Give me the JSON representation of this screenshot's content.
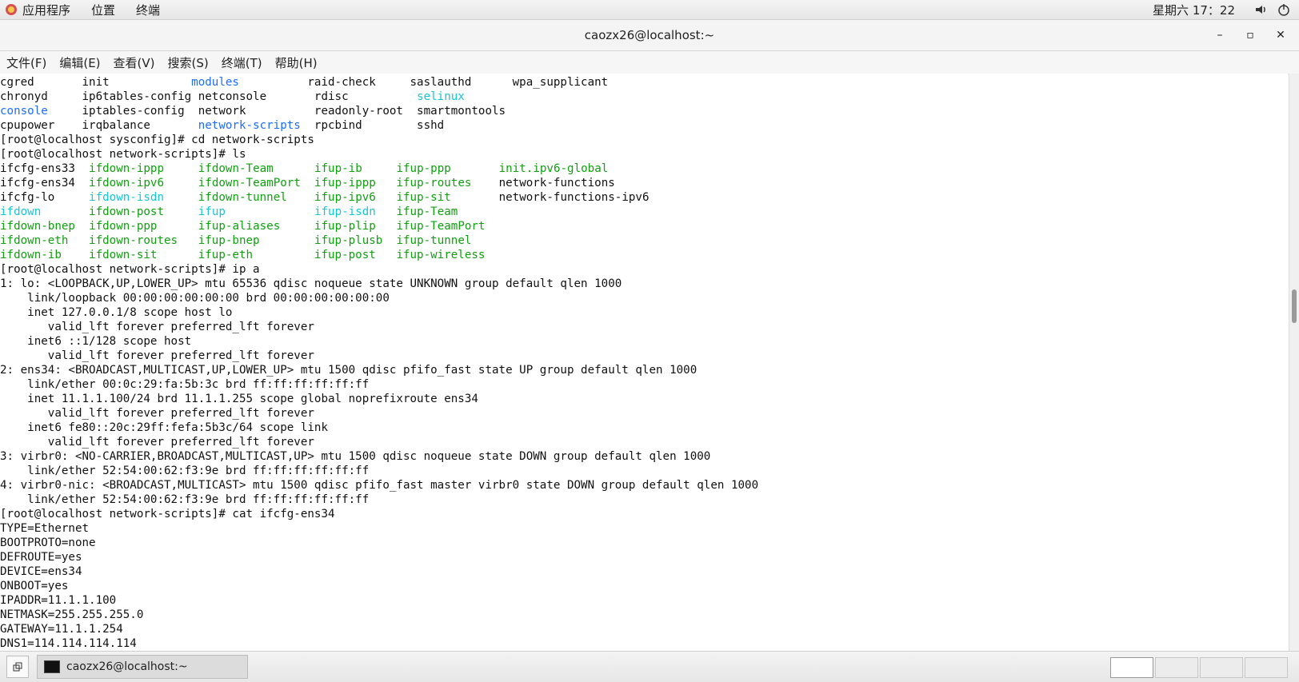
{
  "topbar": {
    "apps_label": "应用程序",
    "places_label": "位置",
    "terminal_label": "终端",
    "clock": "星期六 17：22"
  },
  "window": {
    "title": "caozx26@localhost:~",
    "controls": {
      "minimize": "–",
      "maximize": "▫",
      "close": "✕"
    }
  },
  "menubar": {
    "items": [
      "文件(F)",
      "编辑(E)",
      "查看(V)",
      "搜索(S)",
      "终端(T)",
      "帮助(H)"
    ]
  },
  "terminal": {
    "lines": [
      {
        "segs": [
          {
            "t": "cgred       init            ",
            "c": "normal"
          },
          {
            "t": "modules",
            "c": "blue"
          },
          {
            "t": "          raid-check     saslauthd      wpa_supplicant",
            "c": "normal"
          }
        ]
      },
      {
        "segs": [
          {
            "t": "chronyd     ip6tables-config",
            "c": "normal"
          },
          {
            "t": " ",
            "c": "normal"
          },
          {
            "t": "netconsole       rdisc          ",
            "c": "normal"
          },
          {
            "t": "selinux",
            "c": "cyan"
          }
        ]
      },
      {
        "segs": [
          {
            "t": "console",
            "c": "blue"
          },
          {
            "t": "     iptables-config  network          readonly-root  smartmontools",
            "c": "normal"
          }
        ]
      },
      {
        "segs": [
          {
            "t": "cpupower    irqbalance       ",
            "c": "normal"
          },
          {
            "t": "network-scripts",
            "c": "blue"
          },
          {
            "t": "  rpcbind        sshd",
            "c": "normal"
          }
        ]
      },
      {
        "segs": [
          {
            "t": "[root@localhost sysconfig]# cd network-scripts",
            "c": "normal"
          }
        ]
      },
      {
        "segs": [
          {
            "t": "[root@localhost network-scripts]# ls",
            "c": "normal"
          }
        ]
      },
      {
        "segs": [
          {
            "t": "ifcfg-ens33  ",
            "c": "normal"
          },
          {
            "t": "ifdown-ippp",
            "c": "green"
          },
          {
            "t": "     ",
            "c": "normal"
          },
          {
            "t": "ifdown-Team",
            "c": "green"
          },
          {
            "t": "      ",
            "c": "normal"
          },
          {
            "t": "ifup-ib",
            "c": "green"
          },
          {
            "t": "     ",
            "c": "normal"
          },
          {
            "t": "ifup-ppp",
            "c": "green"
          },
          {
            "t": "       ",
            "c": "normal"
          },
          {
            "t": "init.ipv6-global",
            "c": "green"
          }
        ]
      },
      {
        "segs": [
          {
            "t": "ifcfg-ens34  ",
            "c": "normal"
          },
          {
            "t": "ifdown-ipv6",
            "c": "green"
          },
          {
            "t": "     ",
            "c": "normal"
          },
          {
            "t": "ifdown-TeamPort",
            "c": "green"
          },
          {
            "t": "  ",
            "c": "normal"
          },
          {
            "t": "ifup-ippp",
            "c": "green"
          },
          {
            "t": "   ",
            "c": "normal"
          },
          {
            "t": "ifup-routes",
            "c": "green"
          },
          {
            "t": "    network-functions",
            "c": "normal"
          }
        ]
      },
      {
        "segs": [
          {
            "t": "ifcfg-lo     ",
            "c": "normal"
          },
          {
            "t": "ifdown-isdn",
            "c": "cyan"
          },
          {
            "t": "     ",
            "c": "normal"
          },
          {
            "t": "ifdown-tunnel",
            "c": "green"
          },
          {
            "t": "    ",
            "c": "normal"
          },
          {
            "t": "ifup-ipv6",
            "c": "green"
          },
          {
            "t": "   ",
            "c": "normal"
          },
          {
            "t": "ifup-sit",
            "c": "green"
          },
          {
            "t": "       network-functions-ipv6",
            "c": "normal"
          }
        ]
      },
      {
        "segs": [
          {
            "t": "ifdown",
            "c": "cyan"
          },
          {
            "t": "       ",
            "c": "normal"
          },
          {
            "t": "ifdown-post",
            "c": "green"
          },
          {
            "t": "     ",
            "c": "normal"
          },
          {
            "t": "ifup",
            "c": "cyan"
          },
          {
            "t": "             ",
            "c": "normal"
          },
          {
            "t": "ifup-isdn",
            "c": "cyan"
          },
          {
            "t": "   ",
            "c": "normal"
          },
          {
            "t": "ifup-Team",
            "c": "green"
          }
        ]
      },
      {
        "segs": [
          {
            "t": "ifdown-bnep",
            "c": "green"
          },
          {
            "t": "  ",
            "c": "normal"
          },
          {
            "t": "ifdown-ppp",
            "c": "green"
          },
          {
            "t": "      ",
            "c": "normal"
          },
          {
            "t": "ifup-aliases",
            "c": "green"
          },
          {
            "t": "     ",
            "c": "normal"
          },
          {
            "t": "ifup-plip",
            "c": "green"
          },
          {
            "t": "   ",
            "c": "normal"
          },
          {
            "t": "ifup-TeamPort",
            "c": "green"
          }
        ]
      },
      {
        "segs": [
          {
            "t": "ifdown-eth",
            "c": "green"
          },
          {
            "t": "   ",
            "c": "normal"
          },
          {
            "t": "ifdown-routes",
            "c": "green"
          },
          {
            "t": "   ",
            "c": "normal"
          },
          {
            "t": "ifup-bnep",
            "c": "green"
          },
          {
            "t": "        ",
            "c": "normal"
          },
          {
            "t": "ifup-plusb",
            "c": "green"
          },
          {
            "t": "  ",
            "c": "normal"
          },
          {
            "t": "ifup-tunnel",
            "c": "green"
          }
        ]
      },
      {
        "segs": [
          {
            "t": "ifdown-ib",
            "c": "green"
          },
          {
            "t": "    ",
            "c": "normal"
          },
          {
            "t": "ifdown-sit",
            "c": "green"
          },
          {
            "t": "      ",
            "c": "normal"
          },
          {
            "t": "ifup-eth",
            "c": "green"
          },
          {
            "t": "         ",
            "c": "normal"
          },
          {
            "t": "ifup-post",
            "c": "green"
          },
          {
            "t": "   ",
            "c": "normal"
          },
          {
            "t": "ifup-wireless",
            "c": "green"
          }
        ]
      },
      {
        "segs": [
          {
            "t": "[root@localhost network-scripts]# ip a",
            "c": "normal"
          }
        ]
      },
      {
        "segs": [
          {
            "t": "1: lo: <LOOPBACK,UP,LOWER_UP> mtu 65536 qdisc noqueue state UNKNOWN group default qlen 1000",
            "c": "normal"
          }
        ]
      },
      {
        "segs": [
          {
            "t": "    link/loopback 00:00:00:00:00:00 brd 00:00:00:00:00:00",
            "c": "normal"
          }
        ]
      },
      {
        "segs": [
          {
            "t": "    inet 127.0.0.1/8 scope host lo",
            "c": "normal"
          }
        ]
      },
      {
        "segs": [
          {
            "t": "       valid_lft forever preferred_lft forever",
            "c": "normal"
          }
        ]
      },
      {
        "segs": [
          {
            "t": "    inet6 ::1/128 scope host",
            "c": "normal"
          }
        ]
      },
      {
        "segs": [
          {
            "t": "       valid_lft forever preferred_lft forever",
            "c": "normal"
          }
        ]
      },
      {
        "segs": [
          {
            "t": "2: ens34: <BROADCAST,MULTICAST,UP,LOWER_UP> mtu 1500 qdisc pfifo_fast state UP group default qlen 1000",
            "c": "normal"
          }
        ]
      },
      {
        "segs": [
          {
            "t": "    link/ether 00:0c:29:fa:5b:3c brd ff:ff:ff:ff:ff:ff",
            "c": "normal"
          }
        ]
      },
      {
        "segs": [
          {
            "t": "    inet 11.1.1.100/24 brd 11.1.1.255 scope global noprefixroute ens34",
            "c": "normal"
          }
        ]
      },
      {
        "segs": [
          {
            "t": "       valid_lft forever preferred_lft forever",
            "c": "normal"
          }
        ]
      },
      {
        "segs": [
          {
            "t": "    inet6 fe80::20c:29ff:fefa:5b3c/64 scope link",
            "c": "normal"
          }
        ]
      },
      {
        "segs": [
          {
            "t": "       valid_lft forever preferred_lft forever",
            "c": "normal"
          }
        ]
      },
      {
        "segs": [
          {
            "t": "3: virbr0: <NO-CARRIER,BROADCAST,MULTICAST,UP> mtu 1500 qdisc noqueue state DOWN group default qlen 1000",
            "c": "normal"
          }
        ]
      },
      {
        "segs": [
          {
            "t": "    link/ether 52:54:00:62:f3:9e brd ff:ff:ff:ff:ff:ff",
            "c": "normal"
          }
        ]
      },
      {
        "segs": [
          {
            "t": "4: virbr0-nic: <BROADCAST,MULTICAST> mtu 1500 qdisc pfifo_fast master virbr0 state DOWN group default qlen 1000",
            "c": "normal"
          }
        ]
      },
      {
        "segs": [
          {
            "t": "    link/ether 52:54:00:62:f3:9e brd ff:ff:ff:ff:ff:ff",
            "c": "normal"
          }
        ]
      },
      {
        "segs": [
          {
            "t": "[root@localhost network-scripts]# cat ifcfg-ens34",
            "c": "normal"
          }
        ]
      },
      {
        "segs": [
          {
            "t": "TYPE=Ethernet",
            "c": "normal"
          }
        ]
      },
      {
        "segs": [
          {
            "t": "BOOTPROTO=none",
            "c": "normal"
          }
        ]
      },
      {
        "segs": [
          {
            "t": "DEFROUTE=yes",
            "c": "normal"
          }
        ]
      },
      {
        "segs": [
          {
            "t": "DEVICE=ens34",
            "c": "normal"
          }
        ]
      },
      {
        "segs": [
          {
            "t": "ONBOOT=yes",
            "c": "normal"
          }
        ]
      },
      {
        "segs": [
          {
            "t": "IPADDR=11.1.1.100",
            "c": "normal"
          }
        ]
      },
      {
        "segs": [
          {
            "t": "NETMASK=255.255.255.0",
            "c": "normal"
          }
        ]
      },
      {
        "segs": [
          {
            "t": "GATEWAY=11.1.1.254",
            "c": "normal"
          }
        ]
      },
      {
        "segs": [
          {
            "t": "DNS1=114.114.114.114",
            "c": "normal"
          }
        ]
      }
    ]
  },
  "taskbar": {
    "task_label": "caozx26@localhost:~"
  },
  "colors": {
    "blue": "#1e6cff",
    "green": "#10a010",
    "cyan": "#13c7d6"
  }
}
